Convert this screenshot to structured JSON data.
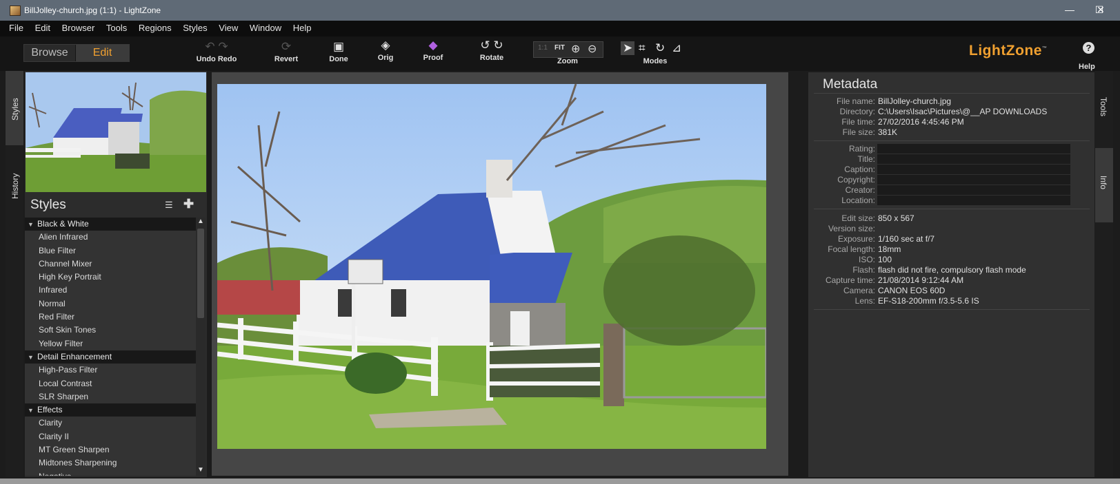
{
  "window": {
    "title": "BillJolley-church.jpg (1:1) - LightZone",
    "minimize": "—",
    "maximize": "☐",
    "close": "✕"
  },
  "menu": [
    "File",
    "Edit",
    "Browser",
    "Tools",
    "Regions",
    "Styles",
    "View",
    "Window",
    "Help"
  ],
  "toolbar": {
    "browse_label": "Browse",
    "edit_label": "Edit",
    "undo_redo_label": "Undo Redo",
    "revert_label": "Revert",
    "done_label": "Done",
    "orig_label": "Orig",
    "proof_label": "Proof",
    "rotate_label": "Rotate",
    "zoom_label": "Zoom",
    "zoom_one": "1:1",
    "zoom_fit": "FIT",
    "modes_label": "Modes",
    "logo": "LightZone",
    "logo_tm": "™",
    "help_label": "Help",
    "help_glyph": "?"
  },
  "left_tabs": {
    "styles": "Styles",
    "history": "History"
  },
  "right_tabs": {
    "tools": "Tools",
    "info": "Info"
  },
  "styles_panel": {
    "title": "Styles",
    "groups": [
      {
        "name": "Black & White",
        "items": [
          "Alien Infrared",
          "Blue Filter",
          "Channel Mixer",
          "High Key Portrait",
          "Infrared",
          "Normal",
          "Red Filter",
          "Soft Skin Tones",
          "Yellow Filter"
        ]
      },
      {
        "name": "Detail Enhancement",
        "items": [
          "High-Pass Filter",
          "Local Contrast",
          "SLR Sharpen"
        ]
      },
      {
        "name": "Effects",
        "items": [
          "Clarity",
          "Clarity II",
          "MT Green Sharpen",
          "Midtones Sharpening",
          "Negative"
        ]
      }
    ]
  },
  "metadata": {
    "title": "Metadata",
    "file_rows": [
      {
        "key": "File name:",
        "value": "BillJolley-church.jpg"
      },
      {
        "key": "Directory:",
        "value": "C:\\Users\\Isac\\Pictures\\@__AP DOWNLOADS"
      },
      {
        "key": "File time:",
        "value": "27/02/2016 4:45:46 PM"
      },
      {
        "key": "File size:",
        "value": "381K"
      }
    ],
    "editable_rows": [
      "Rating:",
      "Title:",
      "Caption:",
      "Copyright:",
      "Creator:",
      "Location:"
    ],
    "exif_rows": [
      {
        "key": "Edit size:",
        "value": "850 x 567"
      },
      {
        "key": "Version size:",
        "value": ""
      },
      {
        "key": "Exposure:",
        "value": "1/160 sec at f/7"
      },
      {
        "key": "Focal length:",
        "value": "18mm"
      },
      {
        "key": "ISO:",
        "value": "100"
      },
      {
        "key": "Flash:",
        "value": "flash did not fire, compulsory flash mode"
      },
      {
        "key": "Capture time:",
        "value": "21/08/2014 9:12:44 AM"
      },
      {
        "key": "Camera:",
        "value": "CANON EOS 60D"
      },
      {
        "key": "Lens:",
        "value": "EF-S18-200mm f/3.5-5.6 IS"
      }
    ]
  },
  "colors": {
    "accent": "#f0a030",
    "toolbar_bg": "#151515",
    "panel_bg": "#303030"
  }
}
